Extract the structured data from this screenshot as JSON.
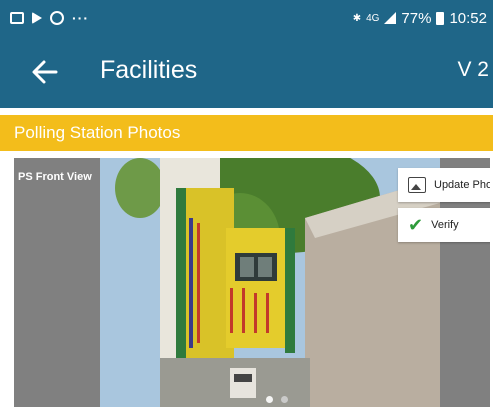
{
  "status_bar": {
    "network": "4G",
    "battery": "77%",
    "time": "10:52"
  },
  "app_bar": {
    "title": "Facilities",
    "version": "V 2"
  },
  "section": {
    "title": "Polling Station Photos"
  },
  "photo": {
    "label": "PS Front View",
    "actions": {
      "update_label": "Update Photo",
      "verify_label": "Verify"
    },
    "carousel_dots": 2,
    "active_dot": 0
  },
  "colors": {
    "primary": "#1f6688",
    "section_header": "#f3bd1b",
    "verify_check": "#2e9b3a",
    "photo_frame": "#808080"
  },
  "icons": [
    "image-icon",
    "play-icon",
    "whatsapp-icon",
    "more-icon",
    "bluetooth-icon",
    "signal-icon",
    "battery-icon",
    "back-arrow-icon",
    "update-photo-icon",
    "check-icon"
  ]
}
